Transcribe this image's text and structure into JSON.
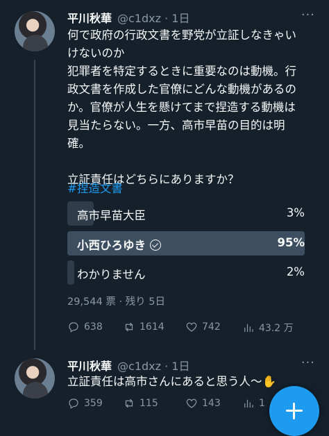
{
  "tweet1": {
    "display_name": "平川秋華",
    "meta": "@c1dxz · 1日",
    "more": "···",
    "text": "何で政府の行政文書を野党が立証しなきゃい\nけないのか\n犯罪者を特定するときに重要なのは動機。行\n政文書を作成した官僚にどんな動機があるの\nか。官僚が人生を懸けてまで捏造する動機は\n見当たらない。一方、高市早苗の目的は明\n確。\n\n立証責任はどちらにありますか？",
    "hashtag": "#捏造文書",
    "poll": {
      "options": [
        {
          "label": "高市早苗大臣",
          "percent": "3%",
          "fraction": 0.11
        },
        {
          "label": "小西ひろゆき",
          "percent": "95%",
          "fraction": 1.0,
          "winner": true
        },
        {
          "label": "わかりません",
          "percent": "2%",
          "fraction": 0.03
        }
      ],
      "meta": "29,544 票 · 残り 5日"
    },
    "actions": {
      "replies": "638",
      "retweets": "1614",
      "likes": "742",
      "views": "43.2 万"
    }
  },
  "tweet2": {
    "display_name": "平川秋華",
    "meta": "@c1dxz · 1日",
    "more": "···",
    "text": "立証責任は高市さんにあると思う人〜",
    "emoji": "✋",
    "actions": {
      "replies": "359",
      "retweets": "115",
      "likes": "143",
      "views": "1"
    }
  },
  "icons": {
    "reply": "reply-icon",
    "retweet": "retweet-icon",
    "like": "heart-icon",
    "views": "views-icon",
    "share": "share-icon",
    "fab": "plus-icon"
  },
  "colors": {
    "background": "#15202b",
    "accent": "#1d9bf0",
    "muted": "#8b98a5"
  }
}
